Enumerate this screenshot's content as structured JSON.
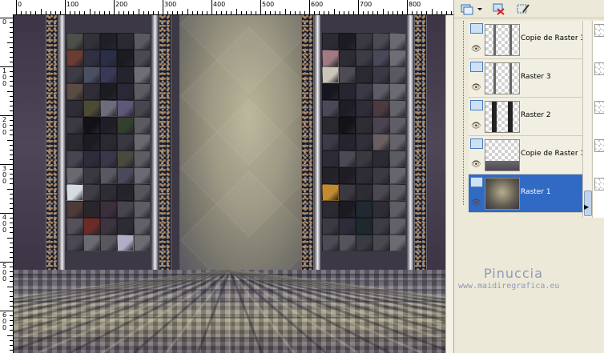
{
  "ruler": {
    "top_labels": [
      "0",
      "100",
      "200",
      "300",
      "400",
      "500",
      "600",
      "700",
      "800"
    ],
    "left_labels": [
      "0",
      "1\n0\n0",
      "2\n0\n0",
      "3\n0\n0",
      "4\n0\n0",
      "5\n0\n0",
      "6\n0\n0"
    ]
  },
  "layers": {
    "items": [
      {
        "name": "Copie de Raster 3",
        "active": false,
        "thumb": "rod-pair"
      },
      {
        "name": "Raster 3",
        "active": false,
        "thumb": "rod-pair"
      },
      {
        "name": "Raster 2",
        "active": false,
        "thumb": "glitter-pair"
      },
      {
        "name": "Copie de Raster 1",
        "active": false,
        "thumb": "floor"
      },
      {
        "name": "Raster 1",
        "active": true,
        "thumb": "scene"
      }
    ]
  },
  "watermark": {
    "title": "Pinuccia",
    "url": "www.maidiregrafica.eu"
  },
  "colors": {
    "active_layer": "#316ac5",
    "panel_bg": "#ece9d8",
    "watermark": "#8f9ab8"
  },
  "icons": {
    "new_layer": "new-layer-icon",
    "delete_layer": "delete-layer-icon",
    "layer_properties": "layer-properties-icon",
    "visibility": "eye-icon"
  }
}
